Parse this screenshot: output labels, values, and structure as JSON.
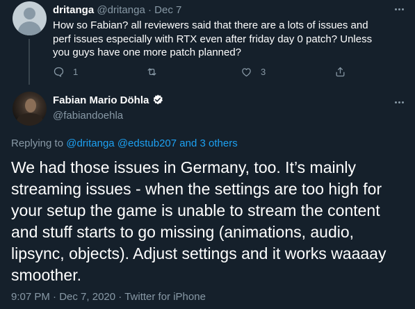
{
  "reply_tweet": {
    "display_name": "dritanga",
    "handle": "@dritanga",
    "separator": "·",
    "date": "Dec 7",
    "text": "How so Fabian? all reviewers said that there are a lots of issues and perf issues especially with RTX even after friday day 0 patch? Unless you guys have one more patch planned?",
    "reply_count": "1",
    "retweet_count": "",
    "like_count": "3"
  },
  "main_tweet": {
    "display_name": "Fabian Mario Döhla",
    "handle": "@fabiandoehla",
    "verified": true,
    "replying_prefix": "Replying to",
    "replying_users": "@dritanga @edstub207",
    "replying_and": "and",
    "replying_others": "3 others",
    "text": "We had those issues in Germany, too. It’s mainly streaming issues - when the settings are too high for your setup the game is unable to stream the content and stuff starts to go missing (animations, audio, lipsync, objects). Adjust settings and it works waaaay smoother.",
    "time": "9:07 PM",
    "separator": "·",
    "date": "Dec 7, 2020",
    "source": "Twitter for iPhone"
  },
  "colors": {
    "background": "#15202b",
    "text": "#ffffff",
    "muted": "#8899a6",
    "link": "#1da1f2",
    "divider": "#38444d"
  },
  "icons": [
    "more-icon",
    "reply-icon",
    "retweet-icon",
    "like-icon",
    "share-icon",
    "verified-badge-icon"
  ]
}
